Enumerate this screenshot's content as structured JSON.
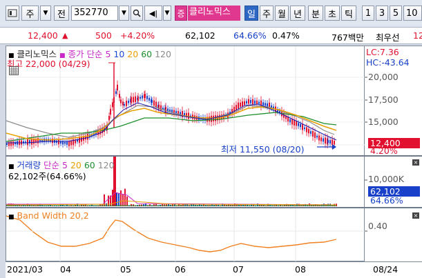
{
  "toolbar": {
    "stock_type_label": "주",
    "all_label": "전",
    "code": "352770",
    "stock_name": "클리노믹스",
    "periods": [
      "일",
      "주",
      "월",
      "년",
      "분",
      "초",
      "틱"
    ],
    "intervals": [
      "1",
      "3",
      "5",
      "10"
    ],
    "active_period": "일"
  },
  "quote": {
    "price": "12,400",
    "change": "500",
    "change_pct": "+4.20%",
    "volume": "62,102",
    "volume_ratio": "64.66%",
    "turnover": "0.47%",
    "amount": "767백만",
    "best_ask_label": "최우선",
    "best_ask_value": "12"
  },
  "price_panel": {
    "name": "클리노믹스",
    "ma_label": "종가 단순",
    "ma_periods": [
      "5",
      "10",
      "20",
      "60",
      "120"
    ],
    "high_annotation": "최고 22,000 (04/29)",
    "low_annotation": "최저 11,550 (08/20)",
    "lc": "LC:7.36",
    "hc": "HC:-43.64",
    "y_ticks": [
      "20,000",
      "17,500",
      "15,000"
    ],
    "current_price_tag": "12,400",
    "current_pct_tag": "4.20%"
  },
  "volume_panel": {
    "label": "거래량",
    "ma_label": "단순",
    "ma_periods": [
      "5",
      "20",
      "60",
      "120"
    ],
    "value": "62,102주(64.66%)",
    "y_tick": "10,000K",
    "value_tag": "62,102",
    "pct_tag": "64.66%"
  },
  "bw_panel": {
    "label": "Band Width 20,2",
    "y_tick": "0.40"
  },
  "x_axis": {
    "labels": [
      "2021/03",
      "04",
      "05",
      "06",
      "07",
      "08"
    ],
    "cursor_date": "08/24"
  },
  "colors": {
    "up": "#e0102e",
    "down": "#1840c8",
    "ma5": "#1a1aa8",
    "ma10": "#1a4ad8",
    "ma20": "#e8a000",
    "ma60": "#1c8f2c",
    "ma120": "#8a8a8a",
    "vol_ma5": "#c828c8",
    "bandwidth": "#f08020"
  }
}
